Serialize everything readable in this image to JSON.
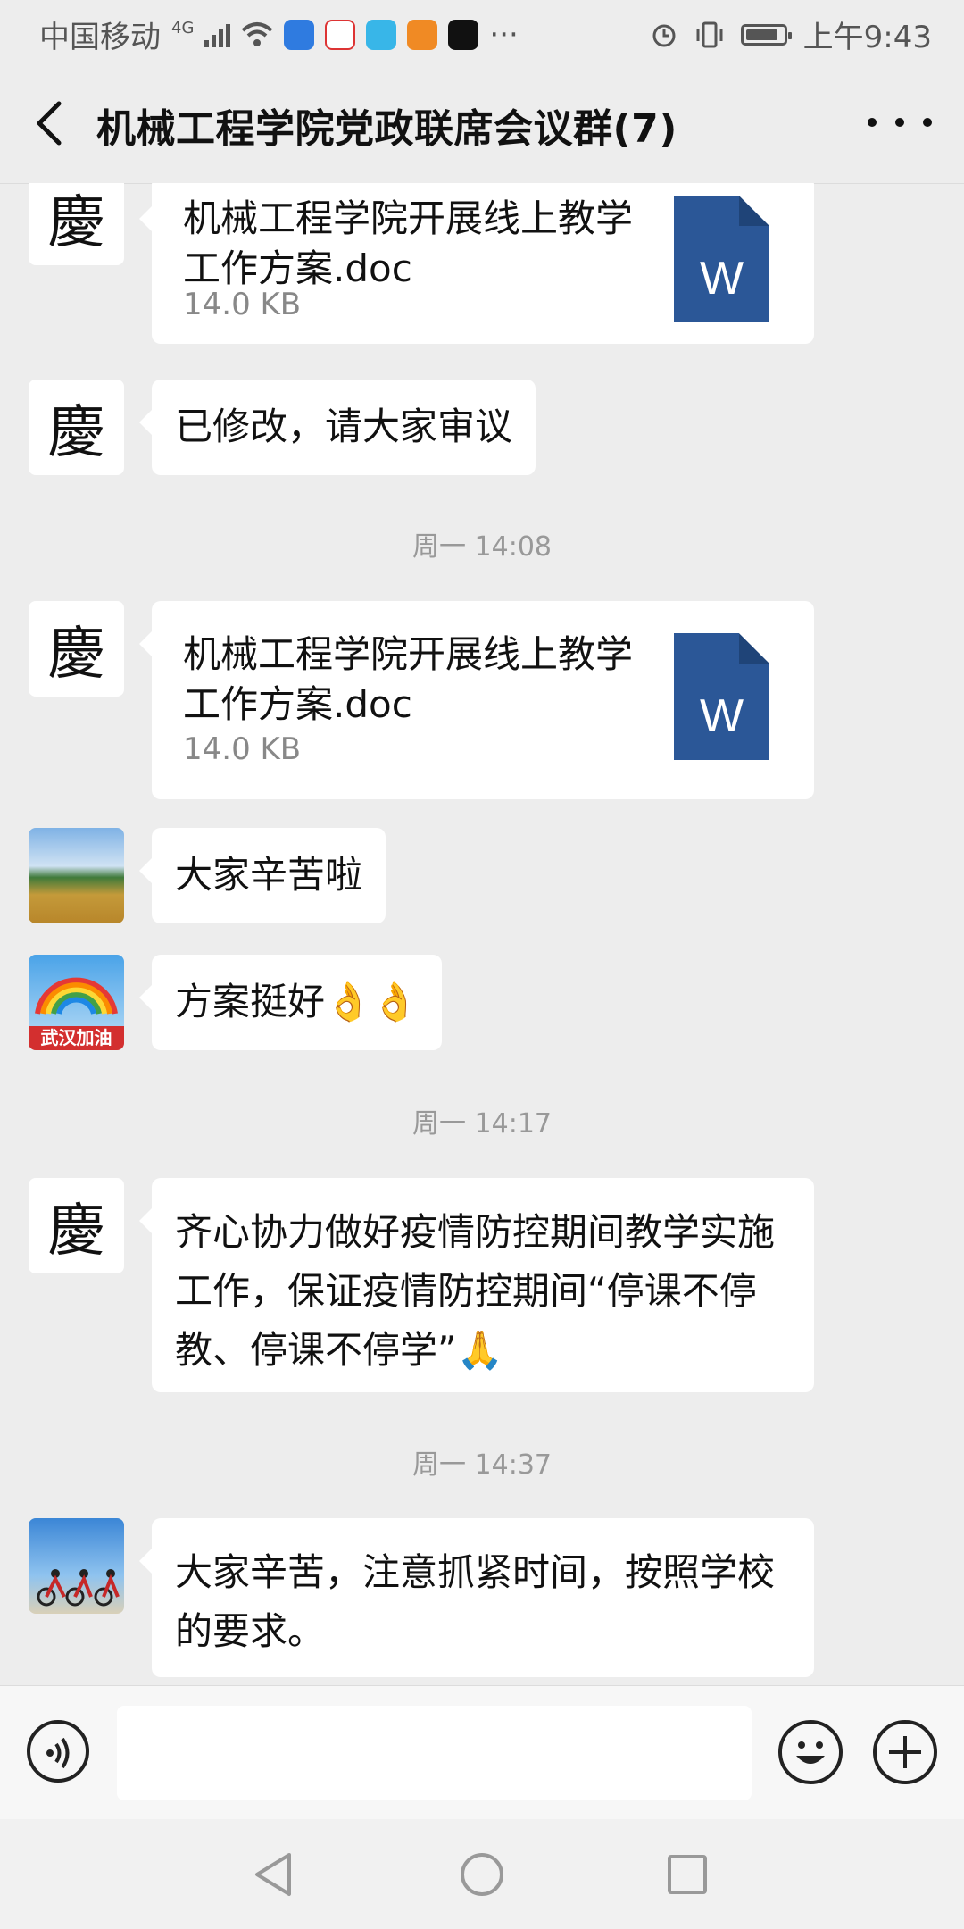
{
  "status": {
    "carrier": "中国移动",
    "network": "4G",
    "time": "上午9:43",
    "more": "···"
  },
  "header": {
    "title": "机械工程学院党政联席会议群(7)"
  },
  "messages": [
    {
      "type": "file",
      "sender": "慶",
      "filename": "机械工程学院开展线上教学工作方案.doc",
      "size": "14.0 KB",
      "icon_letter": "W"
    },
    {
      "type": "text",
      "sender": "慶",
      "text": "已修改，请大家审议"
    },
    {
      "type": "time",
      "text": "周一 14:08"
    },
    {
      "type": "file",
      "sender": "慶",
      "filename": "机械工程学院开展线上教学工作方案.doc",
      "size": "14.0 KB",
      "icon_letter": "W"
    },
    {
      "type": "text",
      "sender_avatar": "field-avatar",
      "text": "大家辛苦啦"
    },
    {
      "type": "text",
      "sender_avatar": "rainbow-avatar",
      "avatar_caption": "武汉加油",
      "text": "方案挺好👌👌"
    },
    {
      "type": "time",
      "text": "周一 14:17"
    },
    {
      "type": "text",
      "sender": "慶",
      "text": "齐心协力做好疫情防控期间教学实施工作，保证疫情防控期间“停课不停教、停课不停学”🙏"
    },
    {
      "type": "time",
      "text": "周一 14:37"
    },
    {
      "type": "text",
      "sender_avatar": "cyclists-avatar",
      "text": "大家辛苦，注意抓紧时间，按照学校的要求。"
    }
  ],
  "input": {
    "value": "",
    "placeholder": ""
  },
  "colors": {
    "background": "#ededed",
    "bubble": "#ffffff",
    "word_icon": "#2b5797",
    "timestamp": "#999999"
  }
}
